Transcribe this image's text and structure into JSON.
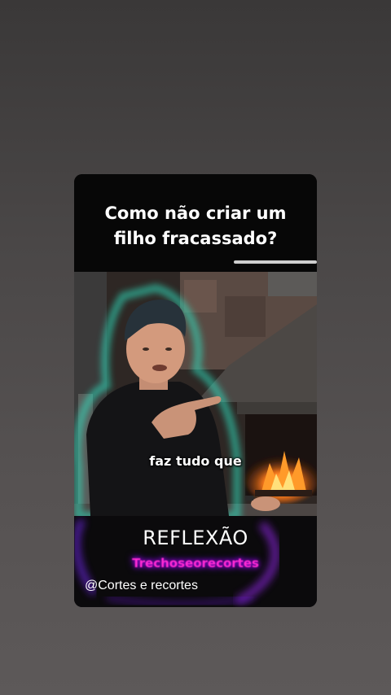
{
  "story": {
    "title_line_1": "Como não criar um",
    "title_line_2": "filho fracassado?",
    "progress": 0.34,
    "caption": "faz tudo que",
    "tag": "REFLEXÃO",
    "watermark": "Trechoseorecortes",
    "handle": "@Cortes e recortes"
  },
  "colors": {
    "page_background": "#4a4747",
    "card_background": "#0a0a0a",
    "text": "#ffffff",
    "glow": "#2fe6c5",
    "watermark": "#ff2bd4"
  }
}
